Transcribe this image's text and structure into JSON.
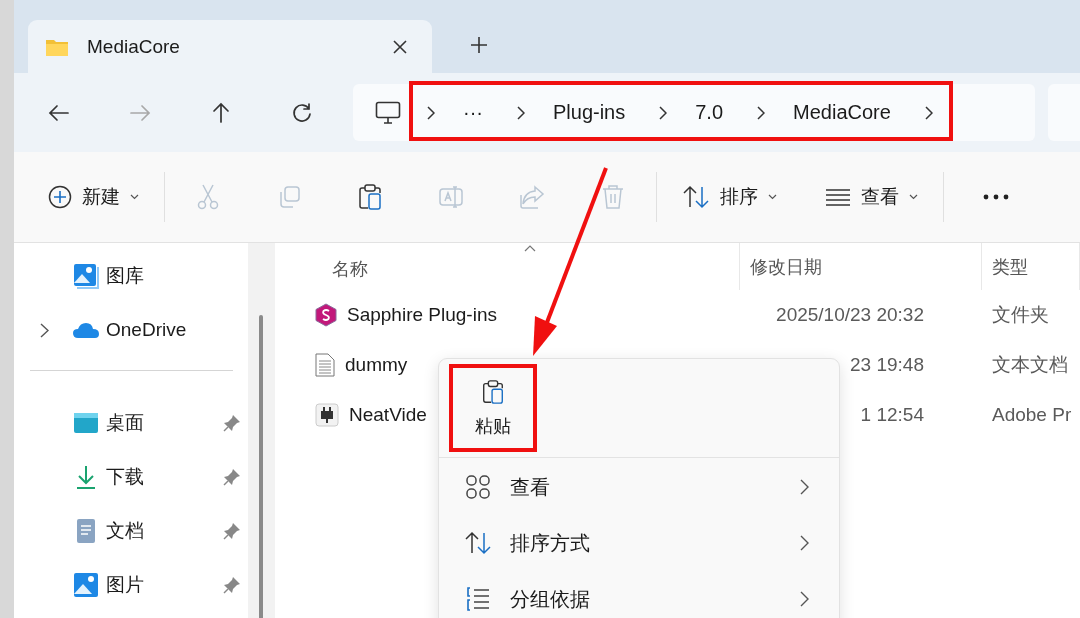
{
  "tab": {
    "title": "MediaCore"
  },
  "nav_buttons": [
    {
      "kind": "back",
      "disabled": false
    },
    {
      "kind": "forward",
      "disabled": true
    },
    {
      "kind": "up",
      "disabled": false
    },
    {
      "kind": "refresh",
      "disabled": false
    }
  ],
  "breadcrumb": [
    "···",
    "Plug-ins",
    "7.0",
    "MediaCore"
  ],
  "toolbar": {
    "new": "新建",
    "actions": [
      {
        "kind": "cut",
        "disabled": true
      },
      {
        "kind": "copy",
        "disabled": true
      },
      {
        "kind": "paste",
        "disabled": false
      },
      {
        "kind": "rename",
        "disabled": true
      },
      {
        "kind": "share",
        "disabled": true
      },
      {
        "kind": "delete",
        "disabled": true
      }
    ],
    "sort": "排序",
    "view": "查看"
  },
  "sidebar": {
    "top": [
      {
        "kind": "gallery",
        "label": "图库"
      },
      {
        "kind": "onedrive",
        "label": "OneDrive",
        "expanded": false
      }
    ],
    "pinned": [
      {
        "kind": "desktop",
        "label": "桌面",
        "pinned": true
      },
      {
        "kind": "downloads",
        "label": "下载",
        "pinned": true
      },
      {
        "kind": "documents",
        "label": "文档",
        "pinned": true
      },
      {
        "kind": "pictures",
        "label": "图片",
        "pinned": true
      }
    ]
  },
  "table": {
    "columns": [
      "名称",
      "修改日期",
      "类型"
    ],
    "rows": [
      {
        "kind": "sapphire",
        "name": "Sapphire Plug-ins",
        "modified": "2025/10/23 20:32",
        "type": "文件夹"
      },
      {
        "kind": "text",
        "name": "dummy",
        "modified": "23 19:48",
        "type": "文本文档"
      },
      {
        "kind": "plugin",
        "name": "NeatVide",
        "modified": "1 12:54",
        "type": "Adobe Pr"
      }
    ]
  },
  "context_menu": {
    "paste": "粘贴",
    "items": [
      {
        "kind": "view",
        "label": "查看",
        "submenu": true
      },
      {
        "kind": "sort",
        "label": "排序方式",
        "submenu": true
      },
      {
        "kind": "group",
        "label": "分组依据",
        "submenu": true
      }
    ]
  }
}
